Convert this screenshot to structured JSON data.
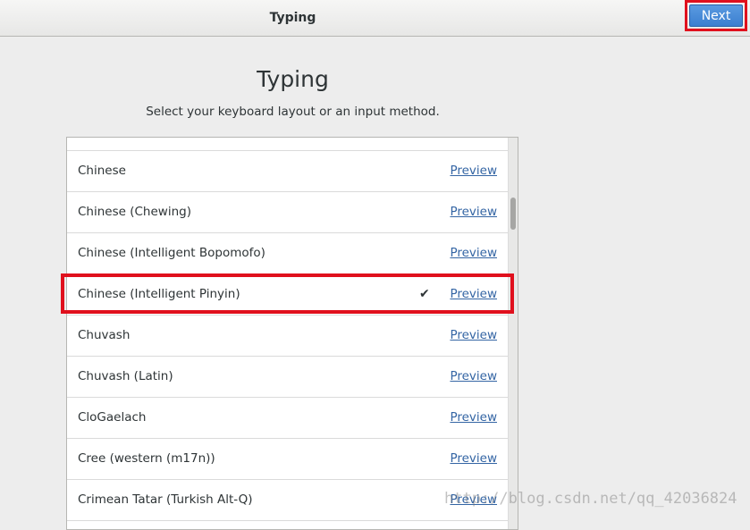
{
  "header": {
    "title": "Typing",
    "next_label": "Next"
  },
  "main": {
    "title": "Typing",
    "subtitle": "Select your keyboard layout or an input method."
  },
  "layouts": [
    {
      "label": "Chinese",
      "preview": "Preview",
      "selected": false
    },
    {
      "label": "Chinese (Chewing)",
      "preview": "Preview",
      "selected": false
    },
    {
      "label": "Chinese (Intelligent Bopomofo)",
      "preview": "Preview",
      "selected": false
    },
    {
      "label": "Chinese (Intelligent Pinyin)",
      "preview": "Preview",
      "selected": true,
      "check": "✔"
    },
    {
      "label": "Chuvash",
      "preview": "Preview",
      "selected": false
    },
    {
      "label": "Chuvash (Latin)",
      "preview": "Preview",
      "selected": false
    },
    {
      "label": "CloGaelach",
      "preview": "Preview",
      "selected": false
    },
    {
      "label": "Cree (western (m17n))",
      "preview": "Preview",
      "selected": false
    },
    {
      "label": "Crimean Tatar (Turkish Alt-Q)",
      "preview": "Preview",
      "selected": false
    }
  ],
  "watermark": "http://blog.csdn.net/qq_42036824",
  "colors": {
    "accent": "#3b7fd0",
    "highlight": "#e0101d",
    "link": "#3465a4"
  }
}
